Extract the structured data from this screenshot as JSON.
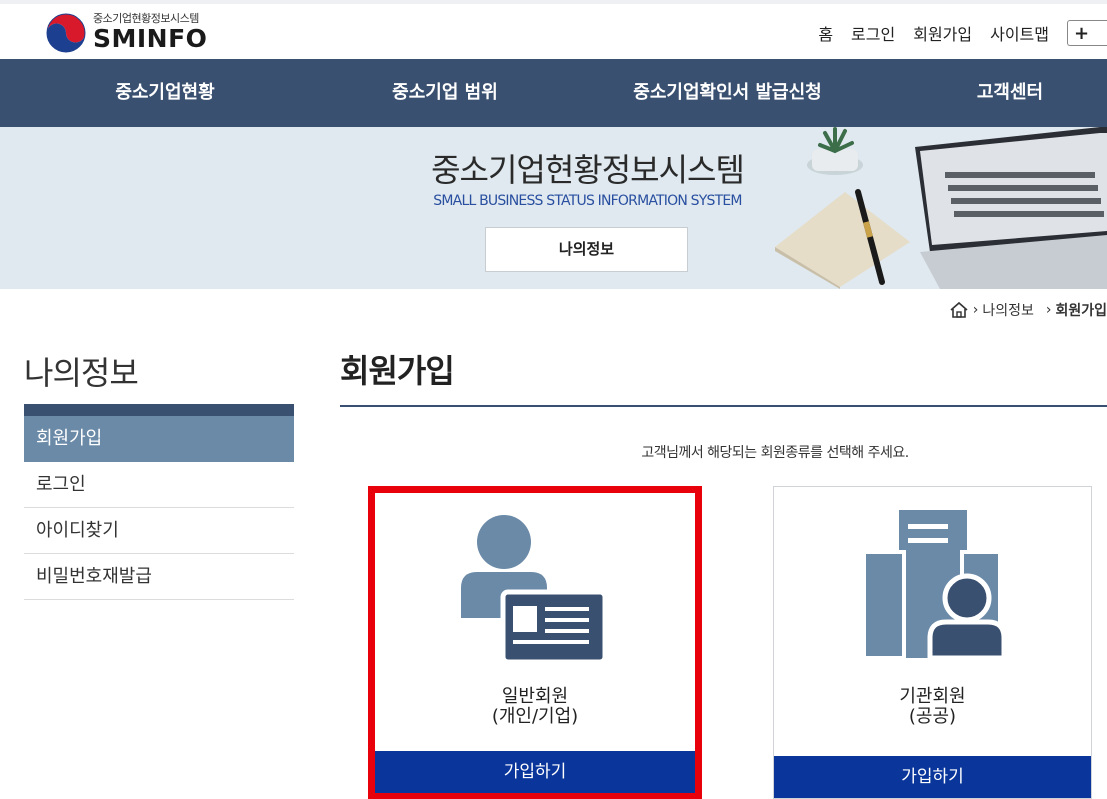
{
  "header": {
    "logo_sub": "중소기업현황정보시스템",
    "logo_main": "SMINFO",
    "util_links": [
      "홈",
      "로그인",
      "회원가입",
      "사이트맵"
    ],
    "zoom_in_symbol": "+"
  },
  "nav": {
    "items": [
      "중소기업현황",
      "중소기업 범위",
      "중소기업확인서 발급신청",
      "고객센터"
    ]
  },
  "banner": {
    "title": "중소기업현황정보시스템",
    "subtitle": "SMALL BUSINESS STATUS INFORMATION SYSTEM",
    "button": "나의정보"
  },
  "breadcrumb": {
    "items": [
      "나의정보",
      "회원가입"
    ]
  },
  "sidebar": {
    "title": "나의정보",
    "items": [
      {
        "label": "회원가입",
        "active": true
      },
      {
        "label": "로그인",
        "active": false
      },
      {
        "label": "아이디찾기",
        "active": false
      },
      {
        "label": "비밀번호재발급",
        "active": false
      }
    ]
  },
  "main": {
    "title": "회원가입",
    "intro": "고객님께서 해당되는 회원종류를 선택해 주세요.",
    "cards": [
      {
        "line1": "일반회원",
        "line2": "(개인/기업)",
        "button": "가입하기",
        "icon": "person-id-card-icon"
      },
      {
        "line1": "기관회원",
        "line2": "(공공)",
        "button": "가입하기",
        "icon": "building-person-icon"
      }
    ]
  },
  "colors": {
    "nav_bg": "#3a5070",
    "active_menu": "#6a8aa8",
    "card_button": "#0a369c",
    "highlight_border": "#e8000b",
    "icon_blue": "#6a8aa8",
    "icon_dark": "#3a5070"
  }
}
